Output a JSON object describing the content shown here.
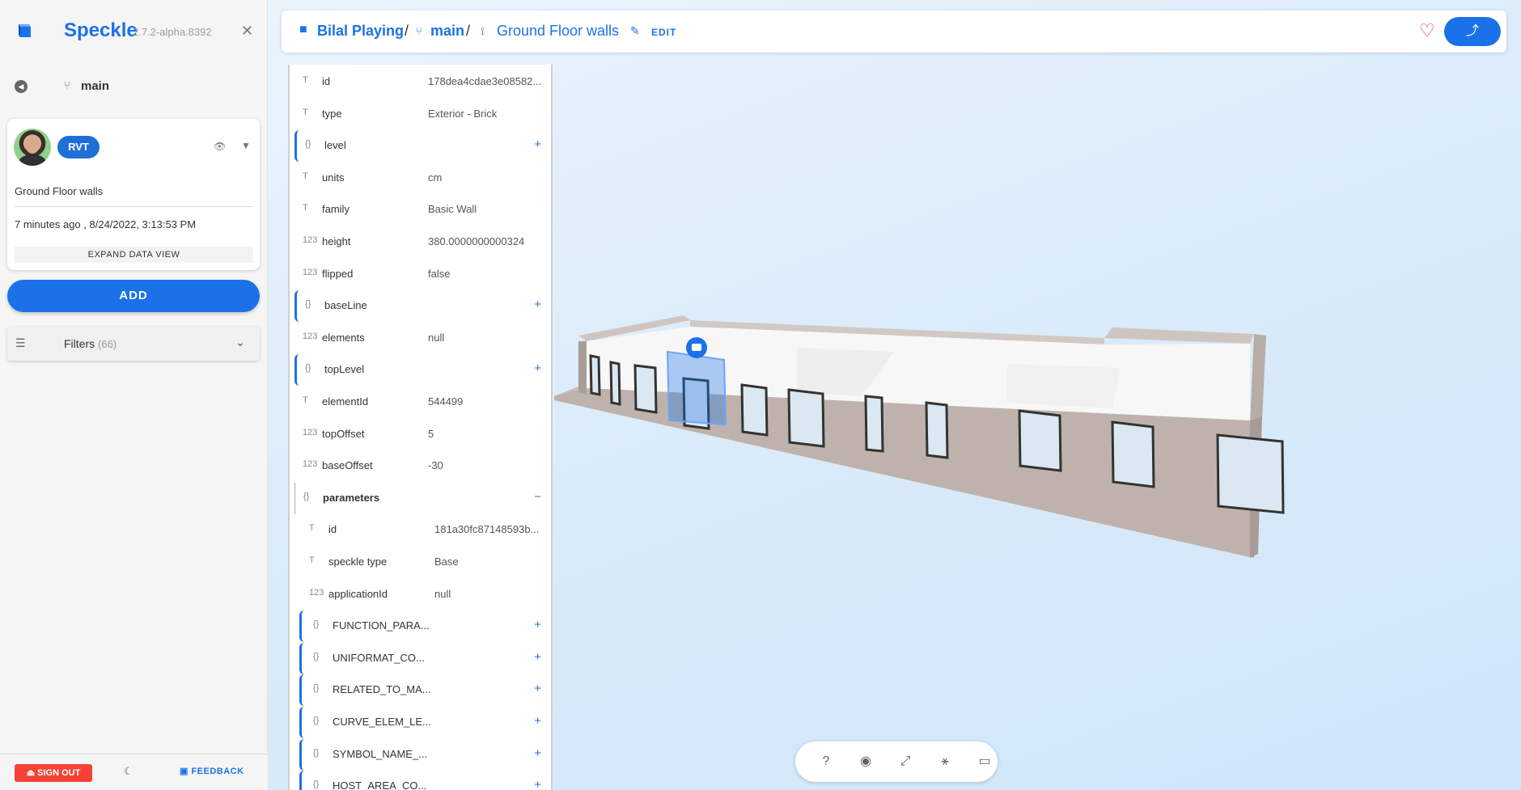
{
  "app": {
    "name": "Speckle",
    "version": "2.7.2-alpha.8392"
  },
  "sidebar": {
    "branch": "main",
    "commit": {
      "source_badge": "RVT",
      "message": "Ground Floor walls",
      "date": "7 minutes ago , 8/24/2022, 3:13:53 PM",
      "expand_label": "EXPAND DATA VIEW"
    },
    "add_label": "ADD",
    "filters": {
      "label": "Filters",
      "count": "(66)"
    },
    "footer": {
      "sign_out": "SIGN OUT",
      "feedback": "FEEDBACK"
    }
  },
  "topbar": {
    "stream": "Bilal Playing",
    "separator": "/",
    "branch": "main",
    "commit": "Ground Floor walls",
    "edit_label": "EDIT"
  },
  "data_tree": {
    "rows": [
      {
        "type": "T",
        "key": "id",
        "value": "178dea4cdae3e08582..."
      },
      {
        "type": "T",
        "key": "type",
        "value": "Exterior - Brick"
      },
      {
        "type": "{}",
        "key": "level",
        "value": ""
      },
      {
        "type": "T",
        "key": "units",
        "value": "cm"
      },
      {
        "type": "T",
        "key": "family",
        "value": "Basic Wall"
      },
      {
        "type": "123",
        "key": "height",
        "value": "380.0000000000324"
      },
      {
        "type": "123",
        "key": "flipped",
        "value": "false"
      },
      {
        "type": "{}",
        "key": "baseLine",
        "value": ""
      },
      {
        "type": "123",
        "key": "elements",
        "value": "null"
      },
      {
        "type": "{}",
        "key": "topLevel",
        "value": ""
      },
      {
        "type": "T",
        "key": "elementId",
        "value": "544499"
      },
      {
        "type": "123",
        "key": "topOffset",
        "value": "5"
      },
      {
        "type": "123",
        "key": "baseOffset",
        "value": "-30"
      },
      {
        "type": "{}",
        "key": "parameters",
        "value": ""
      },
      {
        "type": "T",
        "key": "id",
        "value": "181a30fc87148593b..."
      },
      {
        "type": "T",
        "key": "speckle type",
        "value": "Base"
      },
      {
        "type": "123",
        "key": "applicationId",
        "value": "null"
      },
      {
        "type": "{}",
        "key": "FUNCTION_PARA...",
        "value": ""
      },
      {
        "type": "{}",
        "key": "UNIFORMAT_CO...",
        "value": ""
      },
      {
        "type": "{}",
        "key": "RELATED_TO_MA...",
        "value": ""
      },
      {
        "type": "{}",
        "key": "CURVE_ELEM_LE...",
        "value": ""
      },
      {
        "type": "{}",
        "key": "SYMBOL_NAME_...",
        "value": ""
      },
      {
        "type": "{}",
        "key": "HOST_AREA_CO...",
        "value": ""
      }
    ],
    "expand_symbol": "+",
    "collapse_symbol": "−"
  },
  "toolbar": {
    "help": "?",
    "icons": [
      "help-icon",
      "camera-icon",
      "fullscreen-icon",
      "section-icon",
      "comment-icon"
    ]
  },
  "colors": {
    "accent": "#1b72e8",
    "danger": "#f44336",
    "wall": "#bfb2ac"
  }
}
